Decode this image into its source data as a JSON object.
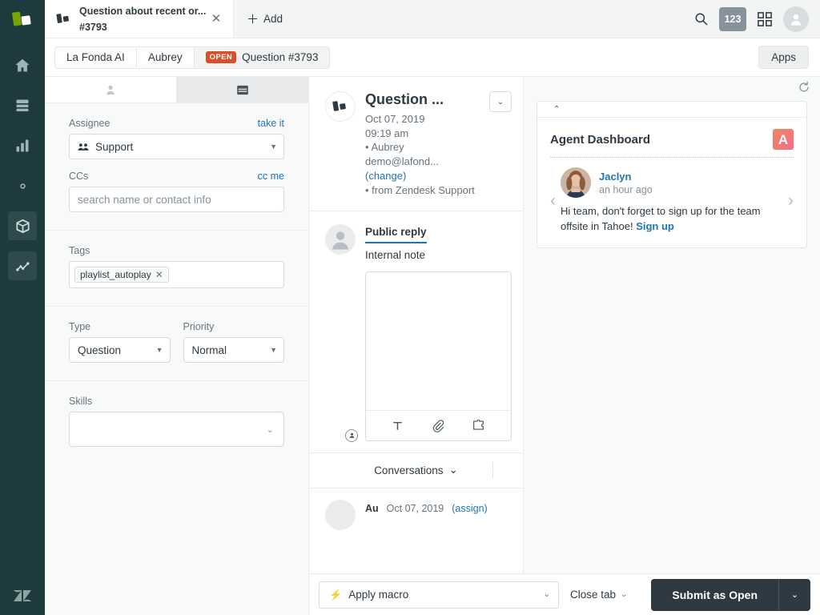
{
  "nav": {
    "brand_icon": "zendesk-product-mark",
    "items": [
      {
        "icon": "home-icon",
        "name": "home",
        "active": false
      },
      {
        "icon": "views-icon",
        "name": "views",
        "active": false
      },
      {
        "icon": "reporting-bar-chart-icon",
        "name": "reporting",
        "active": false
      },
      {
        "icon": "gear-icon",
        "name": "admin",
        "active": false
      },
      {
        "icon": "cube-icon",
        "name": "products",
        "active": true
      },
      {
        "icon": "line-chart-icon",
        "name": "explore",
        "active": true
      }
    ],
    "logo_icon": "zendesk-logo"
  },
  "topbar": {
    "ticket_tab": {
      "title": "Question about recent or...",
      "number": "#3793",
      "icon": "ticket-icon",
      "close_icon": "close-icon"
    },
    "add_label": "Add",
    "add_icon": "plus-icon",
    "search_icon": "search-icon",
    "count_badge": "123",
    "apps_grid_icon": "grid-apps-icon",
    "avatar_icon": "user-avatar-icon"
  },
  "breadcrumb": {
    "items": [
      {
        "label": "La Fonda AI",
        "active": false
      },
      {
        "label": "Aubrey",
        "active": false
      },
      {
        "label": "Question #3793",
        "active": true,
        "badge": "OPEN"
      }
    ],
    "badge_color": "#d8502a",
    "apps_button": "Apps"
  },
  "properties": {
    "tabs": [
      {
        "name": "customer-context-tab",
        "icon": "user-icon",
        "active": false
      },
      {
        "name": "ticket-properties-tab",
        "icon": "ticket-properties-icon",
        "active": true
      }
    ],
    "assignee": {
      "label": "Assignee",
      "action": "take it",
      "value": "Support",
      "icon": "group-icon"
    },
    "ccs": {
      "label": "CCs",
      "action": "cc me",
      "placeholder": "search name or contact info",
      "value": ""
    },
    "tags": {
      "label": "Tags",
      "chips": [
        "playlist_autoplay"
      ]
    },
    "type": {
      "label": "Type",
      "value": "Question"
    },
    "priority": {
      "label": "Priority",
      "value": "Normal"
    },
    "skills": {
      "label": "Skills",
      "value": ""
    }
  },
  "conversation": {
    "event": {
      "title": "Question ...",
      "date": "Oct 07, 2019",
      "time": "09:19 am",
      "requester": "• Aubrey",
      "email": "demo@lafond...",
      "change_link": "(change)",
      "via": "• from Zendesk Support",
      "avatar_icon": "ticket-icon",
      "caret_icon": "chevron-down-icon"
    },
    "composer": {
      "tab_public": "Public reply",
      "tab_internal": "Internal note",
      "active_tab": "Public reply",
      "body": "",
      "toolbar": [
        {
          "icon": "text-format-icon",
          "name": "text-format"
        },
        {
          "icon": "paperclip-icon",
          "name": "attach-file"
        },
        {
          "icon": "apps-puzzle-icon",
          "name": "apps"
        }
      ]
    },
    "conversations_bar": {
      "label": "Conversations",
      "caret_icon": "chevron-down-icon"
    },
    "next_row": {
      "name": "Au",
      "date": "Oct 07, 2019",
      "assign_link": "(assign)"
    }
  },
  "apps_panel": {
    "refresh_icon": "refresh-icon",
    "collapse_icon": "chevron-up-icon",
    "card": {
      "title": "Agent Dashboard",
      "logo_letter": "A",
      "logo_gradient_from": "#f4845f",
      "logo_gradient_to": "#f06f88",
      "prev_icon": "chevron-left-icon",
      "next_icon": "chevron-right-icon",
      "post": {
        "author": "Jaclyn",
        "time": "an hour ago",
        "text": "Hi team, don't forget to sign up for the team offsite in Tahoe! ",
        "link": "Sign up",
        "avatar_icon": "user-photo-avatar"
      }
    }
  },
  "footer": {
    "macro": {
      "label": "Apply macro",
      "icon": "lightning-bolt-icon",
      "caret_icon": "chevron-down-icon"
    },
    "close_tab": {
      "label": "Close tab",
      "caret_icon": "chevron-down-icon"
    },
    "submit": {
      "label": "Submit as Open",
      "caret_icon": "chevron-down-icon",
      "color": "#2f3941"
    }
  }
}
